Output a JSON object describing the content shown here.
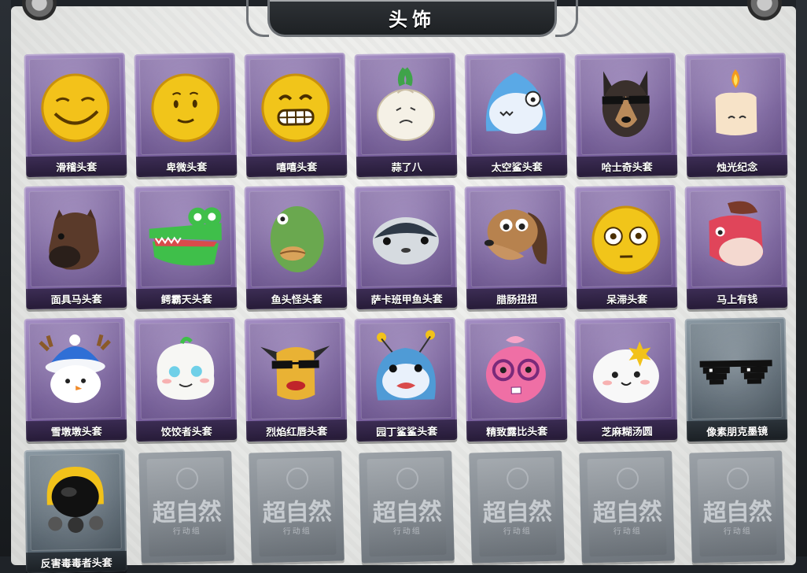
{
  "title": "头饰",
  "items": [
    {
      "label": "滑稽头套",
      "icon": "smirk-emoji-mask-icon",
      "theme": "purple"
    },
    {
      "label": "卑微头套",
      "icon": "timid-emoji-mask-icon",
      "theme": "purple"
    },
    {
      "label": "嘻嘻头套",
      "icon": "grin-emoji-mask-icon",
      "theme": "purple"
    },
    {
      "label": "蒜了八",
      "icon": "garlic-mask-icon",
      "theme": "purple"
    },
    {
      "label": "太空鲨头套",
      "icon": "space-shark-mask-icon",
      "theme": "purple"
    },
    {
      "label": "哈士奇头套",
      "icon": "husky-mask-icon",
      "theme": "purple"
    },
    {
      "label": "烛光纪念",
      "icon": "candle-mask-icon",
      "theme": "purple"
    },
    {
      "label": "面具马头套",
      "icon": "horse-mask-icon",
      "theme": "purple"
    },
    {
      "label": "鳄霸天头套",
      "icon": "crocodile-mask-icon",
      "theme": "purple"
    },
    {
      "label": "鱼头怪头套",
      "icon": "fishhead-mask-icon",
      "theme": "purple"
    },
    {
      "label": "萨卡班甲鱼头套",
      "icon": "sacabambaspis-mask-icon",
      "theme": "purple"
    },
    {
      "label": "腊肠扭扭",
      "icon": "dachshund-mask-icon",
      "theme": "purple"
    },
    {
      "label": "呆滞头套",
      "icon": "stare-emoji-mask-icon",
      "theme": "purple"
    },
    {
      "label": "马上有钱",
      "icon": "pink-horse-mask-icon",
      "theme": "purple"
    },
    {
      "label": "雪墩墩头套",
      "icon": "snowman-mask-icon",
      "theme": "purple"
    },
    {
      "label": "饺饺者头套",
      "icon": "dumpling-mask-icon",
      "theme": "purple"
    },
    {
      "label": "烈焰红唇头套",
      "icon": "yellow-lips-mask-icon",
      "theme": "purple"
    },
    {
      "label": "园丁鲨鲨头套",
      "icon": "gardener-shark-mask-icon",
      "theme": "purple"
    },
    {
      "label": "精致露比头套",
      "icon": "pink-beaver-mask-icon",
      "theme": "purple"
    },
    {
      "label": "芝麻糊汤圆",
      "icon": "tangyuan-mask-icon",
      "theme": "purple"
    },
    {
      "label": "像素朋克墨镜",
      "icon": "pixel-sunglasses-icon",
      "theme": "grey"
    },
    {
      "label": "反害毒毒者头套",
      "icon": "gas-mask-helmet-icon",
      "theme": "grey"
    }
  ],
  "locked_slots": [
    {
      "watermark": "超自然",
      "sub": "行动组"
    },
    {
      "watermark": "超自然",
      "sub": "行动组"
    },
    {
      "watermark": "超自然",
      "sub": "行动组"
    },
    {
      "watermark": "超自然",
      "sub": "行动组"
    },
    {
      "watermark": "超自然",
      "sub": "行动组"
    },
    {
      "watermark": "超自然",
      "sub": "行动组"
    }
  ]
}
